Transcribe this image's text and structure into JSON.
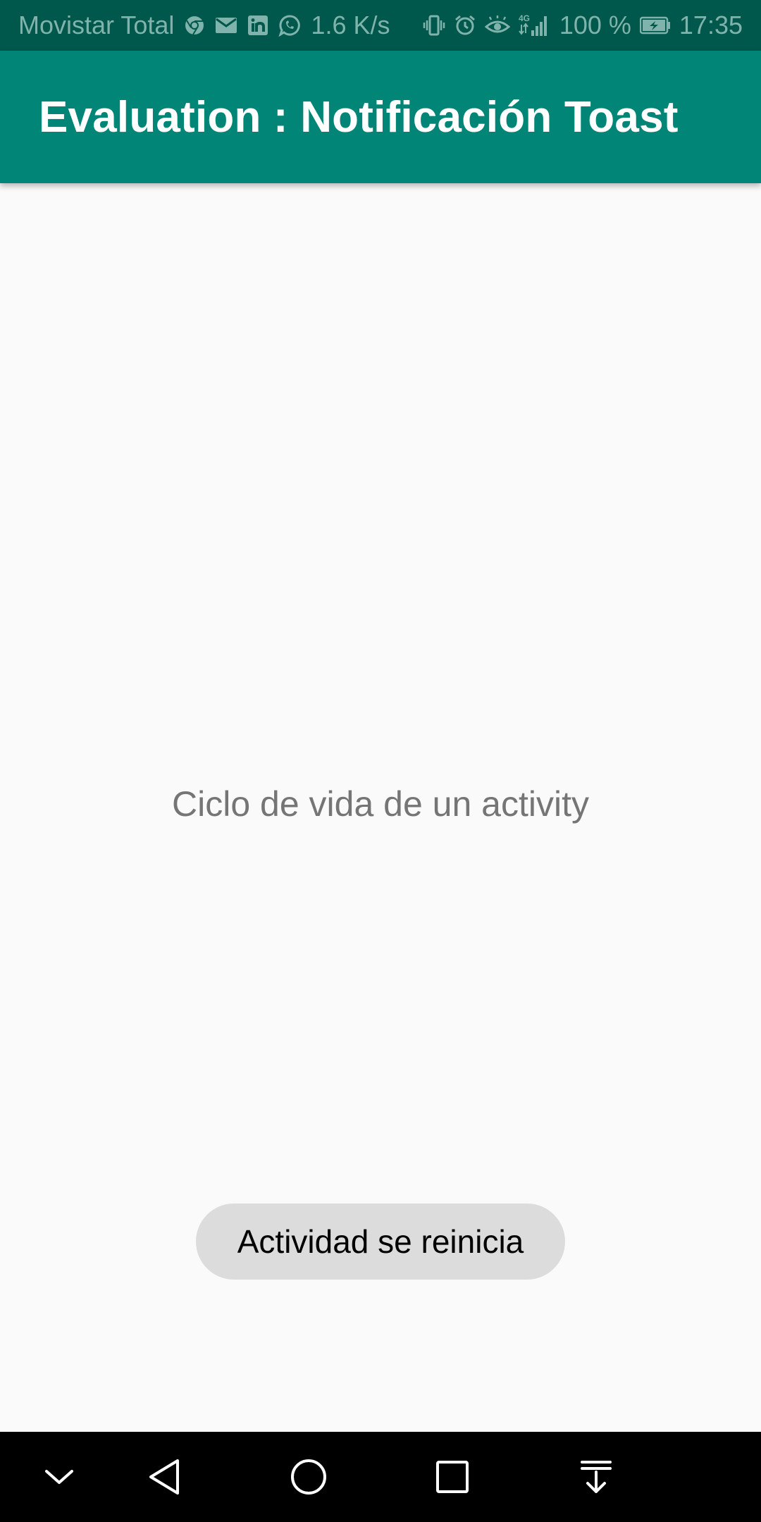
{
  "status_bar": {
    "carrier": "Movistar Total",
    "net_speed": "1.6 K/s",
    "network_type": "4G",
    "battery": "100 %",
    "time": "17:35",
    "icons": [
      "chrome-icon",
      "mail-icon",
      "linkedin-icon",
      "whatsapp-icon",
      "vibrate-icon",
      "alarm-icon",
      "eye-comfort-icon",
      "signal-icon",
      "battery-charging-icon"
    ]
  },
  "app_bar": {
    "title": "Evaluation : Notificación Toast"
  },
  "main": {
    "label": "Ciclo de vida de un activity"
  },
  "toast": {
    "message": "Actividad se reinicia"
  },
  "nav_bar": {
    "buttons": [
      "hide-nav-icon",
      "back-icon",
      "home-icon",
      "recents-icon",
      "notification-pull-icon"
    ]
  },
  "colors": {
    "status_bar": "#00574b",
    "app_bar": "#008577",
    "background": "#fafafa",
    "toast_bg": "#dcdcdc",
    "body_text": "#757575"
  }
}
